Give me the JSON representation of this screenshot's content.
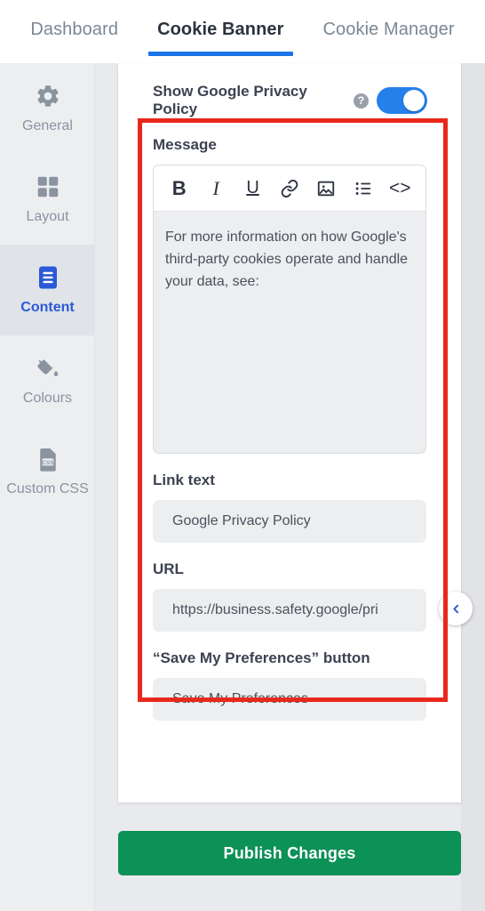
{
  "tabs": [
    {
      "label": "Dashboard",
      "active": false
    },
    {
      "label": "Cookie Banner",
      "active": true
    },
    {
      "label": "Cookie Manager",
      "active": false
    }
  ],
  "sidebar": {
    "items": [
      {
        "label": "General",
        "icon": "gear-icon",
        "active": false
      },
      {
        "label": "Layout",
        "icon": "grid-icon",
        "active": false
      },
      {
        "label": "Content",
        "icon": "document-lines-icon",
        "active": true
      },
      {
        "label": "Colours",
        "icon": "paint-bucket-icon",
        "active": false
      },
      {
        "label": "Custom CSS",
        "icon": "css-file-icon",
        "active": false
      }
    ]
  },
  "panel": {
    "toggle": {
      "label": "Show Google Privacy Policy",
      "help_glyph": "?",
      "state": "on"
    },
    "message": {
      "label": "Message",
      "toolbar": [
        {
          "name": "bold-icon",
          "glyph": "B"
        },
        {
          "name": "italic-icon",
          "glyph": "I"
        },
        {
          "name": "underline-icon",
          "glyph": "U"
        },
        {
          "name": "link-icon",
          "glyph": "link"
        },
        {
          "name": "image-icon",
          "glyph": "image"
        },
        {
          "name": "bullet-list-icon",
          "glyph": "list"
        },
        {
          "name": "code-icon",
          "glyph": "<>"
        }
      ],
      "value": "For more information on how Google's third-party cookies operate and handle your data, see:"
    },
    "link_text": {
      "label": "Link text",
      "value": "Google Privacy Policy"
    },
    "url": {
      "label": "URL",
      "value": "https://business.safety.google/pri"
    },
    "save_button_field": {
      "label": "“Save My Preferences” button",
      "value": "Save My Preferences"
    }
  },
  "footer": {
    "publish_label": "Publish Changes"
  },
  "colors": {
    "accent_blue": "#1a73e8",
    "active_blue": "#2b59d8",
    "toggle_blue": "#2680eb",
    "publish_green": "#0c9156",
    "highlight_red": "#e8281c"
  }
}
